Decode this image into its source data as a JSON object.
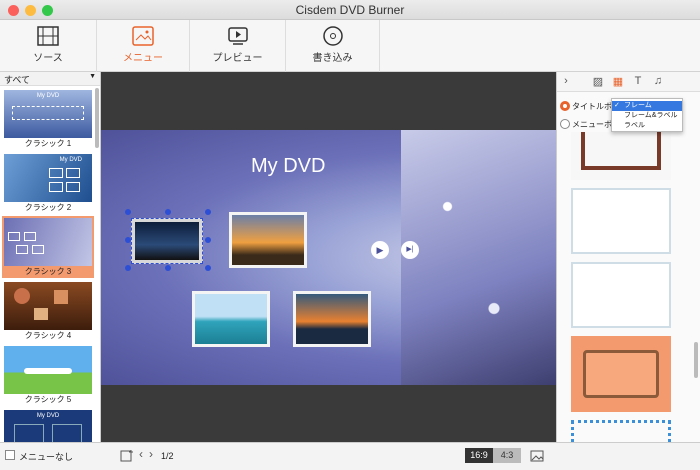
{
  "window": {
    "title": "Cisdem DVD Burner"
  },
  "toolbar": {
    "items": [
      {
        "label": "ソース",
        "icon": "film-icon"
      },
      {
        "label": "メニュー",
        "icon": "menu-template-icon"
      },
      {
        "label": "プレビュー",
        "icon": "preview-play-icon"
      },
      {
        "label": "書き込み",
        "icon": "disc-burn-icon"
      }
    ],
    "active": "メニュー",
    "accent": "#e8622b"
  },
  "sidebar": {
    "filter": "すべて",
    "templates": [
      {
        "label": "クラシック 1",
        "title": "My DVD"
      },
      {
        "label": "クラシック 2",
        "title": "My DVD"
      },
      {
        "label": "クラシック 3",
        "title": ""
      },
      {
        "label": "クラシック 4",
        "title": ""
      },
      {
        "label": "クラシック 5",
        "title": ""
      },
      {
        "label": "",
        "title": "My DVD"
      }
    ],
    "selected_index": 2
  },
  "canvas": {
    "title": "My DVD",
    "play_icon": "▶",
    "next_icon": "▶|"
  },
  "right_panel": {
    "tab_icons": [
      "chevron-right-icon",
      "background-icon",
      "frame-grid-icon",
      "text-style-icon",
      "music-icon"
    ],
    "title_button_label": "タイトルボタ",
    "menu_button_label": "メニューボタ",
    "dropdown_options": [
      "フレーム",
      "フレーム&ラベル",
      "ラベル"
    ],
    "dropdown_selected": "フレーム"
  },
  "bottom": {
    "no_menu_label": "メニューなし",
    "page": "1/2",
    "ratios": [
      "16:9",
      "4:3"
    ],
    "active_ratio": "16:9"
  }
}
